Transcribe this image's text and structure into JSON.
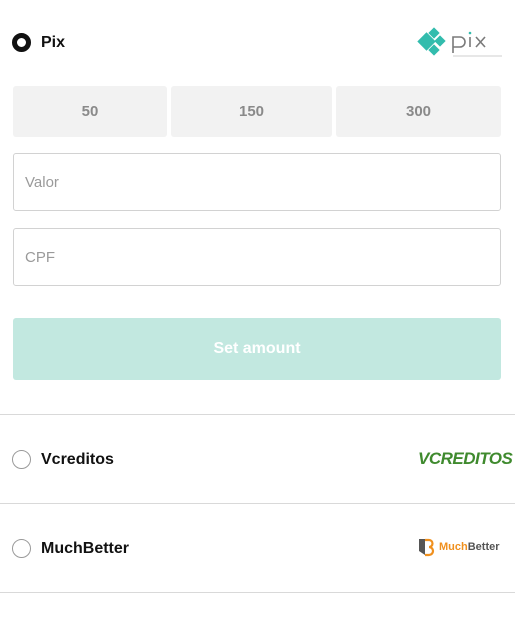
{
  "methods": [
    {
      "label": "Pix",
      "selected": true,
      "logo_text": "pix"
    },
    {
      "label": "Vcreditos",
      "selected": false,
      "logo_text": "VCREDITOS"
    },
    {
      "label": "MuchBetter",
      "selected": false,
      "logo_text_a": "Much",
      "logo_text_b": "Better"
    }
  ],
  "amounts": [
    "50",
    "150",
    "300"
  ],
  "fields": {
    "amount_placeholder": "Valor",
    "cpf_placeholder": "CPF"
  },
  "submit_label": "Set amount",
  "colors": {
    "pix_accent": "#32bcad",
    "submit_disabled": "#c2e8e0",
    "vcreditos_green": "#3f8a2e",
    "muchbetter_orange": "#f0901e"
  },
  "icons": {
    "pix": "pix-logo-icon",
    "vcreditos": "vcreditos-logo-icon",
    "muchbetter": "muchbetter-logo-icon"
  }
}
